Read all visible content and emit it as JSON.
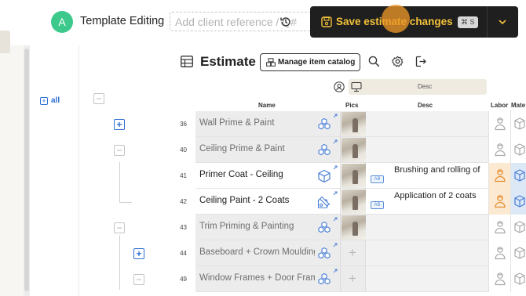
{
  "header": {
    "avatar_initial": "A",
    "app_title": "Template Editing",
    "client_ref_placeholder": "Add client reference / Q#",
    "save_label": "Save estimate changes",
    "shortcut": "⌘ S",
    "accent_color": "#f3c23a",
    "avatar_color": "#3cc98b"
  },
  "sidebar": {
    "filter_label": "all"
  },
  "toolbar": {
    "title": "Estimate",
    "catalog_button": "Manage item catalog",
    "icons": [
      "search-icon",
      "settings-icon",
      "export-icon"
    ]
  },
  "columns": {
    "toggle_desc": "Desc",
    "headers": [
      "Name",
      "Pics",
      "Desc",
      "Labor",
      "Mate"
    ]
  },
  "rows": [
    {
      "line": "36",
      "name": "Wall Prime & Paint",
      "expander": "plus",
      "style": "grey",
      "icon": "cubes-icon",
      "pic": "photo",
      "desc": "",
      "labor": "off",
      "material": "off"
    },
    {
      "line": "40",
      "name": "Ceiling Prime & Paint",
      "expander": "minus",
      "style": "grey",
      "icon": "cubes-icon",
      "pic": "photo",
      "desc": "",
      "labor": "off",
      "material": "off"
    },
    {
      "line": "41",
      "name": "Primer Coat - Ceiling",
      "expander": "",
      "style": "white",
      "icon": "cube-icon",
      "pic": "photo",
      "desc": "Brushing and rolling of",
      "labor": "on",
      "material": "on"
    },
    {
      "line": "42",
      "name": "Ceiling Paint - 2 Coats",
      "expander": "",
      "style": "white",
      "icon": "custom-item-icon",
      "pic": "photo",
      "desc": "Application of 2 coats",
      "labor": "on",
      "material": "on"
    },
    {
      "line": "43",
      "name": "Trim Priming & Painting",
      "expander": "minus",
      "style": "grey",
      "icon": "cubes-icon",
      "pic": "photo",
      "desc": "",
      "labor": "off",
      "material": "off"
    },
    {
      "line": "44",
      "name": "Baseboard + Crown Moulding",
      "expander": "plus",
      "style": "grey",
      "icon": "cubes-icon",
      "pic": "add",
      "desc": "",
      "labor": "off",
      "material": "off"
    },
    {
      "line": "49",
      "name": "Window Frames + Door Frames",
      "expander": "minus",
      "style": "grey",
      "icon": "cubes-icon",
      "pic": "add",
      "desc": "",
      "labor": "off",
      "material": "off"
    }
  ]
}
